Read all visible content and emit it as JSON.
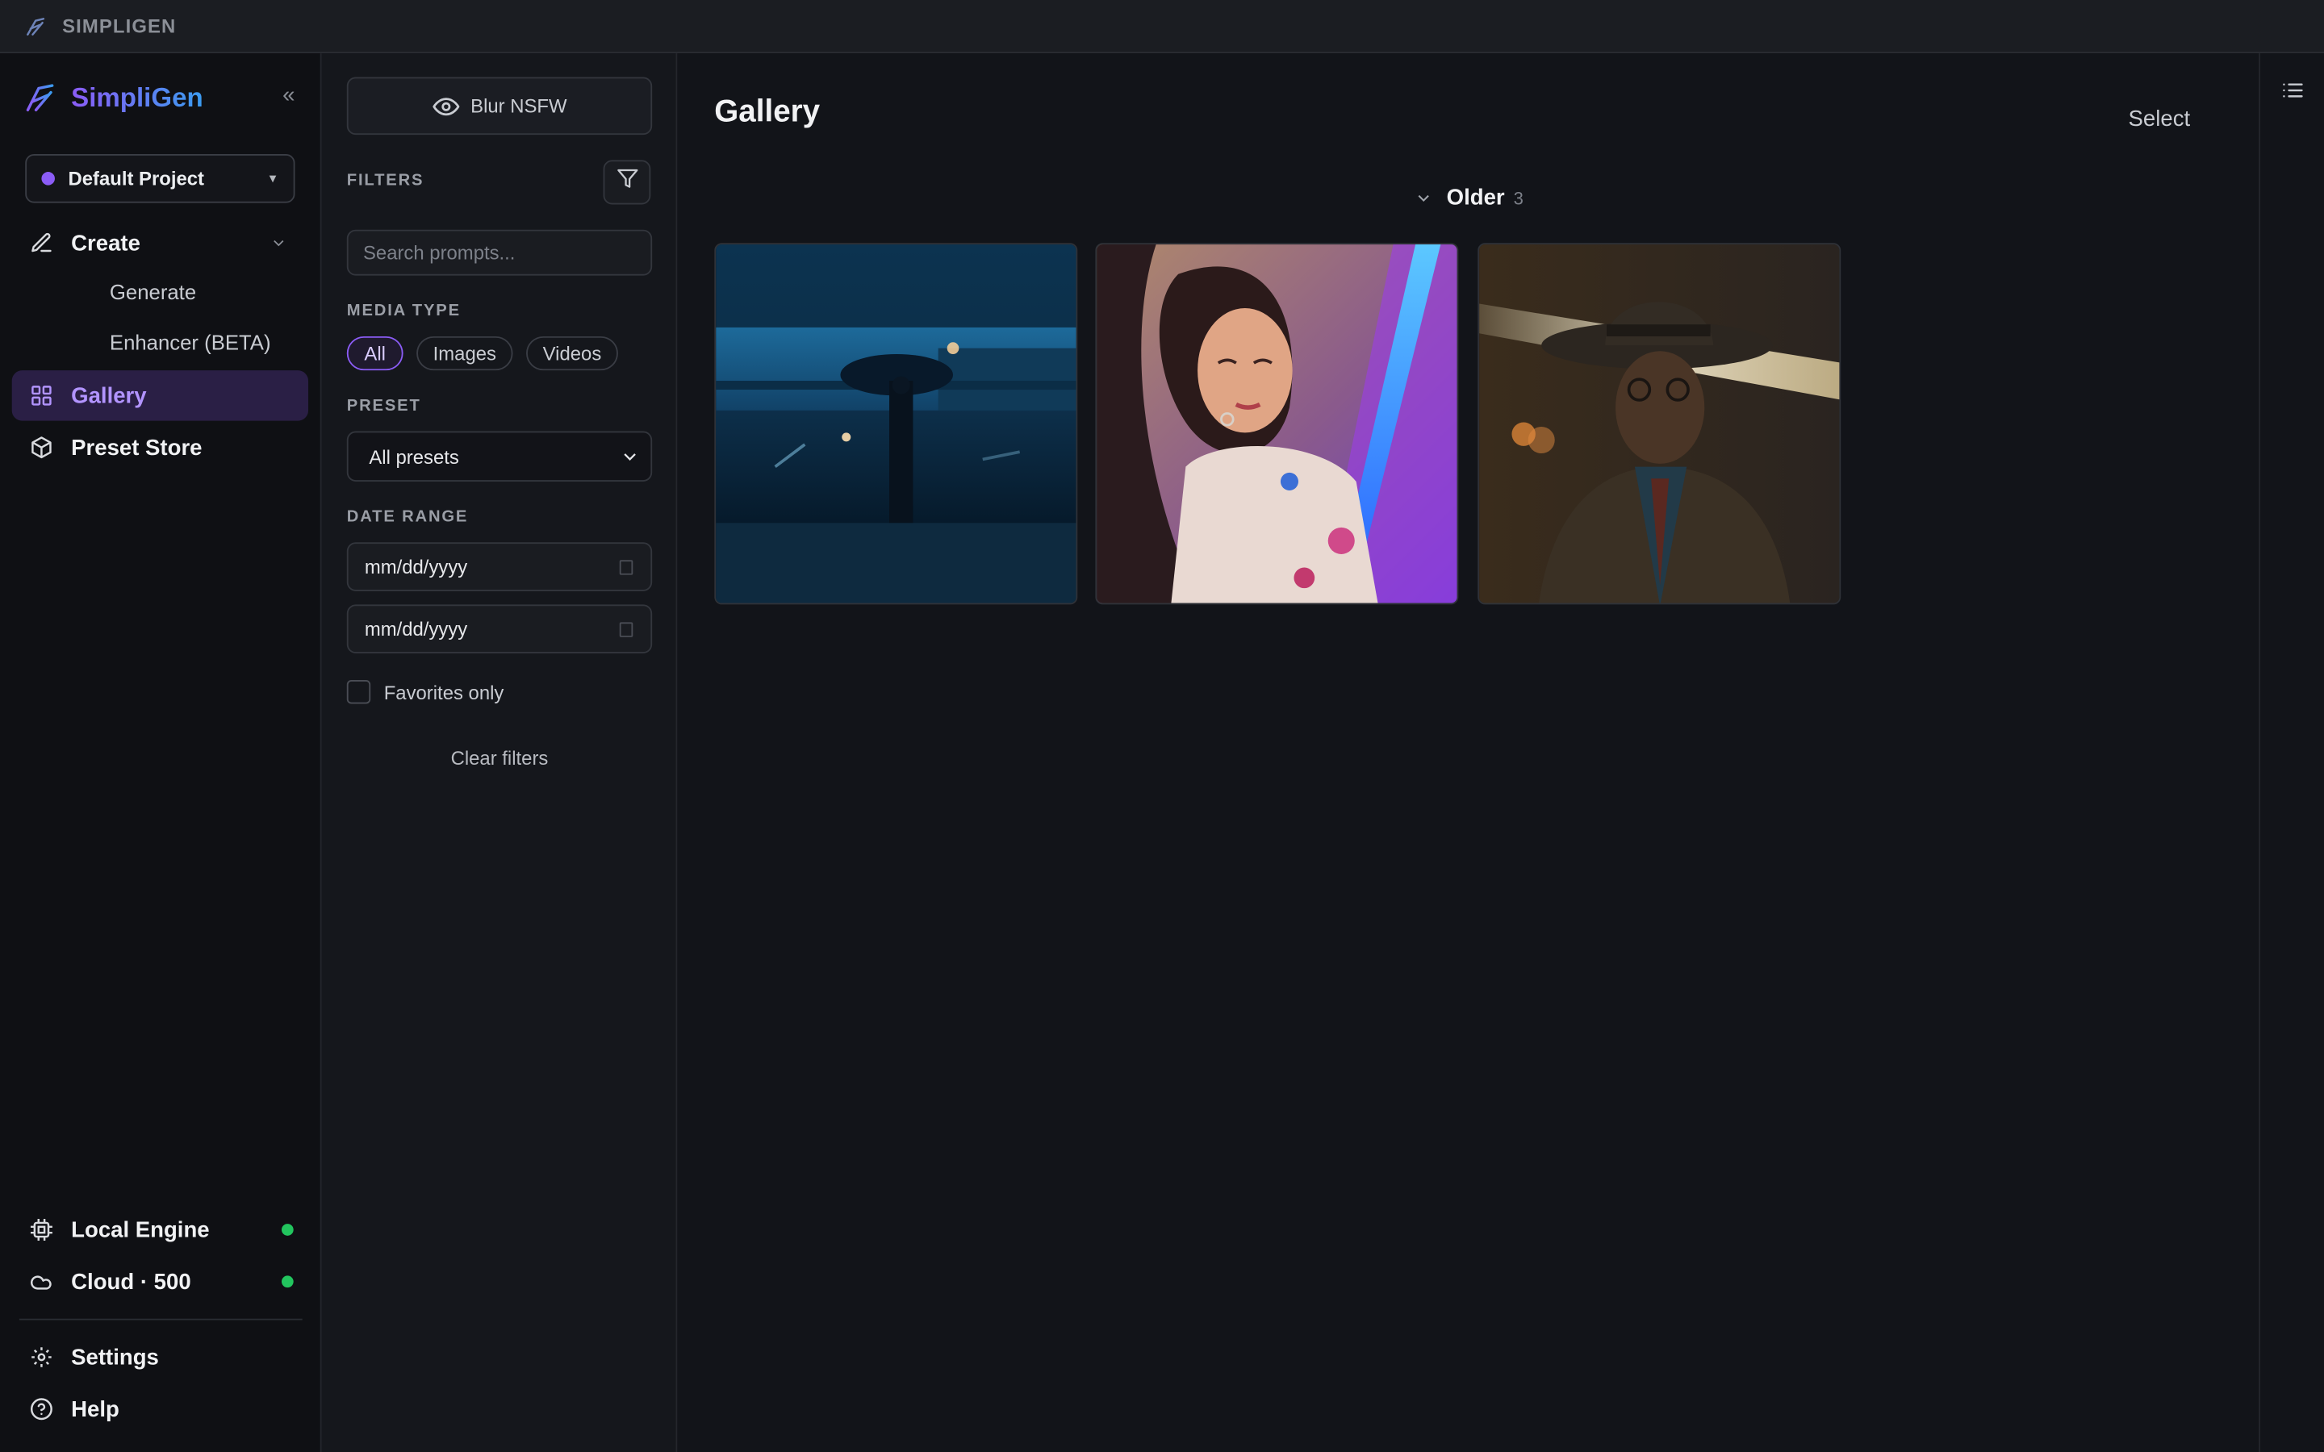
{
  "titlebar": {
    "title": "SIMPLIGEN"
  },
  "sidebar": {
    "brand": "SimpliGen",
    "collapse_icon": "«",
    "project": {
      "label": "Default Project",
      "color": "#8b5cf6"
    },
    "nav": {
      "create": "Create",
      "generate": "Generate",
      "enhancer": "Enhancer (BETA)",
      "gallery": "Gallery",
      "preset_store": "Preset Store",
      "local_engine": "Local Engine",
      "cloud": "Cloud · 500",
      "settings": "Settings",
      "help": "Help"
    },
    "status_color": "#22c55e",
    "active_item": "Gallery"
  },
  "filters": {
    "blur_button": "Blur NSFW",
    "title": "FILTERS",
    "search_placeholder": "Search prompts...",
    "media_type_label": "MEDIA TYPE",
    "media_types": [
      "All",
      "Images",
      "Videos"
    ],
    "media_type_selected": "All",
    "preset_label": "PRESET",
    "preset_value": "All presets",
    "date_range_label": "DATE RANGE",
    "date_from": "mm/dd/yyyy",
    "date_to": "mm/dd/yyyy",
    "favorites_label": "Favorites only",
    "clear_label": "Clear filters"
  },
  "main": {
    "title": "Gallery",
    "select_label": "Select",
    "group": {
      "label": "Older",
      "count": "3"
    },
    "items": [
      {
        "kind": "image",
        "subject": "person-with-umbrella-rainy-street"
      },
      {
        "kind": "image",
        "subject": "woman-neon-light-portrait"
      },
      {
        "kind": "image",
        "subject": "man-in-fedora-noir"
      }
    ]
  },
  "colors": {
    "accent": "#8b5cf6",
    "accent_text": "#b294ff",
    "background": "#121419"
  }
}
